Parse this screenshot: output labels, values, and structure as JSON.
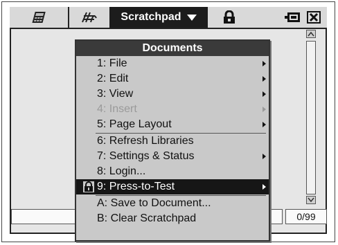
{
  "toolbar": {
    "calculator_icon": "calculator-icon",
    "graph_icon": "graph-icon",
    "tab_label": "Scratchpad",
    "lock_icon": "lock-icon",
    "battery_icon": "battery-icon",
    "close_icon": "close-icon"
  },
  "menu": {
    "title": "Documents",
    "items": [
      {
        "label": "1: File",
        "has_submenu": true,
        "enabled": true
      },
      {
        "label": "2: Edit",
        "has_submenu": true,
        "enabled": true
      },
      {
        "label": "3: View",
        "has_submenu": true,
        "enabled": true
      },
      {
        "label": "4: Insert",
        "has_submenu": true,
        "enabled": false
      },
      {
        "label": "5: Page Layout",
        "has_submenu": true,
        "enabled": true
      },
      {
        "label": "6: Refresh Libraries",
        "has_submenu": false,
        "enabled": true
      },
      {
        "label": "7: Settings & Status",
        "has_submenu": true,
        "enabled": true
      },
      {
        "label": "8: Login...",
        "has_submenu": false,
        "enabled": true
      },
      {
        "label": "9: Press-to-Test",
        "has_submenu": true,
        "enabled": true,
        "selected": true,
        "icon": "lock-icon"
      },
      {
        "label": "A: Save to Document...",
        "has_submenu": false,
        "enabled": true
      },
      {
        "label": "B: Clear Scratchpad",
        "has_submenu": false,
        "enabled": true
      }
    ]
  },
  "status": {
    "counter": "0/99"
  },
  "colors": {
    "menu_bg": "#c9c9c9",
    "header_bg": "#3a3a3a",
    "selected_bg": "#161616",
    "disabled_text": "#9a9a9a"
  }
}
